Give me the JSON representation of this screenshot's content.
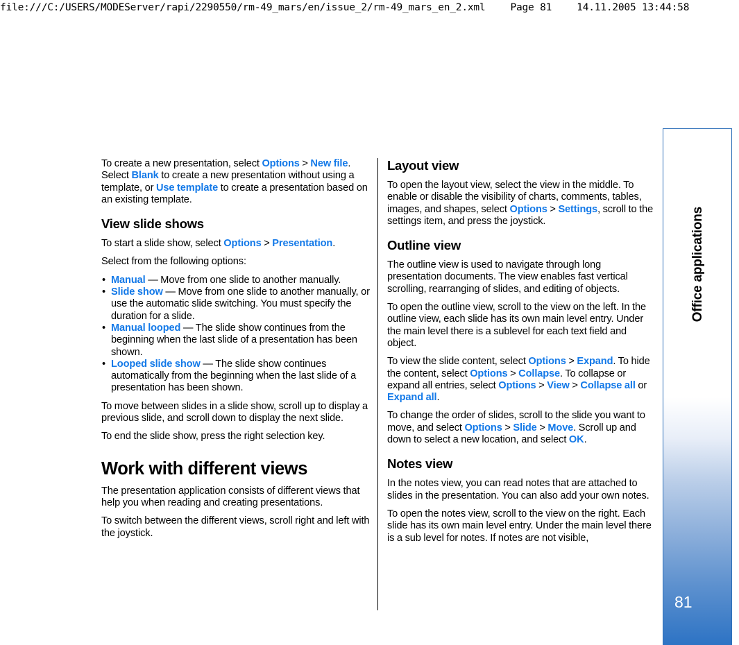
{
  "print_header": {
    "url": "file:///C:/USERS/MODEServer/rapi/2290550/rm-49_mars/en/issue_2/rm-49_mars_en_2.xml",
    "page_label": "Page 81",
    "timestamp": "14.11.2005 13:44:58"
  },
  "side_tab": {
    "label": "Office applications",
    "page_number": "81",
    "border_color": "#2d6fb8",
    "gradient_bottom_color": "#2d73c4"
  },
  "colors": {
    "ui_term": "#1379e8",
    "text": "#000000",
    "background": "#ffffff"
  },
  "left_column": {
    "intro_paragraph": {
      "seg1": "To create a new presentation, select ",
      "ui1": "Options",
      "arrow1": " > ",
      "ui2": "New file",
      "seg2": ". Select ",
      "ui3": "Blank",
      "seg3": " to create a new presentation without using a template, or ",
      "ui4": "Use template",
      "seg4": " to create a presentation based on an existing template."
    },
    "section_heading": "View slide shows",
    "start_paragraph": {
      "seg1": "To start a slide show, select ",
      "ui1": "Options",
      "arrow1": " > ",
      "ui2": "Presentation",
      "seg2": "."
    },
    "options_lead": "Select from the following options:",
    "bullets": [
      {
        "term": "Manual",
        "description": " — Move from one slide to another manually."
      },
      {
        "term": "Slide show",
        "description": " — Move from one slide to another manually, or use the automatic slide switching. You must specify the duration for a slide."
      },
      {
        "term": "Manual looped",
        "description": " — The slide show continues from the beginning when the last slide of a presentation has been shown."
      },
      {
        "term": "Looped slide show",
        "description": " — The slide show continues automatically from the beginning when the last slide of a presentation has been shown."
      }
    ],
    "move_paragraph": "To move between slides in a slide show, scroll up to display a previous slide, and scroll down to display the next slide.",
    "end_paragraph": "To end the slide show, press the right selection key.",
    "chapter_heading": "Work with different views",
    "views_paragraph": "The presentation application consists of different views that help you when reading and creating presentations.",
    "switch_paragraph": "To switch between the different views, scroll right and left with the joystick."
  },
  "right_column": {
    "layout_heading": "Layout view",
    "layout_paragraph": {
      "seg1": "To open the layout view, select the view in the middle. To enable or disable the visibility of charts, comments, tables, images, and shapes, select ",
      "ui1": "Options",
      "arrow1": " > ",
      "ui2": "Settings",
      "seg2": ", scroll to the settings item, and press the joystick."
    },
    "outline_heading": "Outline view",
    "outline_paragraph_1": "The outline view is used to navigate through long presentation documents. The view enables fast vertical scrolling, rearranging of slides, and editing of objects.",
    "outline_paragraph_2": "To open the outline view, scroll to the view on the left. In the outline view, each slide has its own main level entry. Under the main level there is a sublevel for each text field and object.",
    "view_content_paragraph": {
      "seg1": "To view the slide content, select ",
      "ui1": "Options",
      "arrow1": " > ",
      "ui2": "Expand",
      "seg2": ". To hide the content, select ",
      "ui3": "Options",
      "arrow2": " > ",
      "ui4": "Collapse",
      "seg3": ". To collapse or expand all entries, select ",
      "ui5": "Options",
      "arrow3": " > ",
      "ui6": "View",
      "arrow4": " > ",
      "ui7": "Collapse all",
      "seg4": " or ",
      "ui8": "Expand all",
      "seg5": "."
    },
    "order_paragraph": {
      "seg1": "To change the order of slides, scroll to the slide you want to move, and select ",
      "ui1": "Options",
      "arrow1": " > ",
      "ui2": "Slide",
      "arrow2": " > ",
      "ui3": "Move",
      "seg2": ". Scroll up and down to select a new location, and select ",
      "ui4": "OK",
      "seg3": "."
    },
    "notes_heading": "Notes view",
    "notes_paragraph_1": "In the notes view, you can read notes that are attached to slides in the presentation. You can also add your own notes.",
    "notes_paragraph_2": "To open the notes view, scroll to the view on the right. Each slide has its own main level entry. Under the main level there is a sub level for notes. If notes are not visible,"
  },
  "bullet_glyph": "•"
}
